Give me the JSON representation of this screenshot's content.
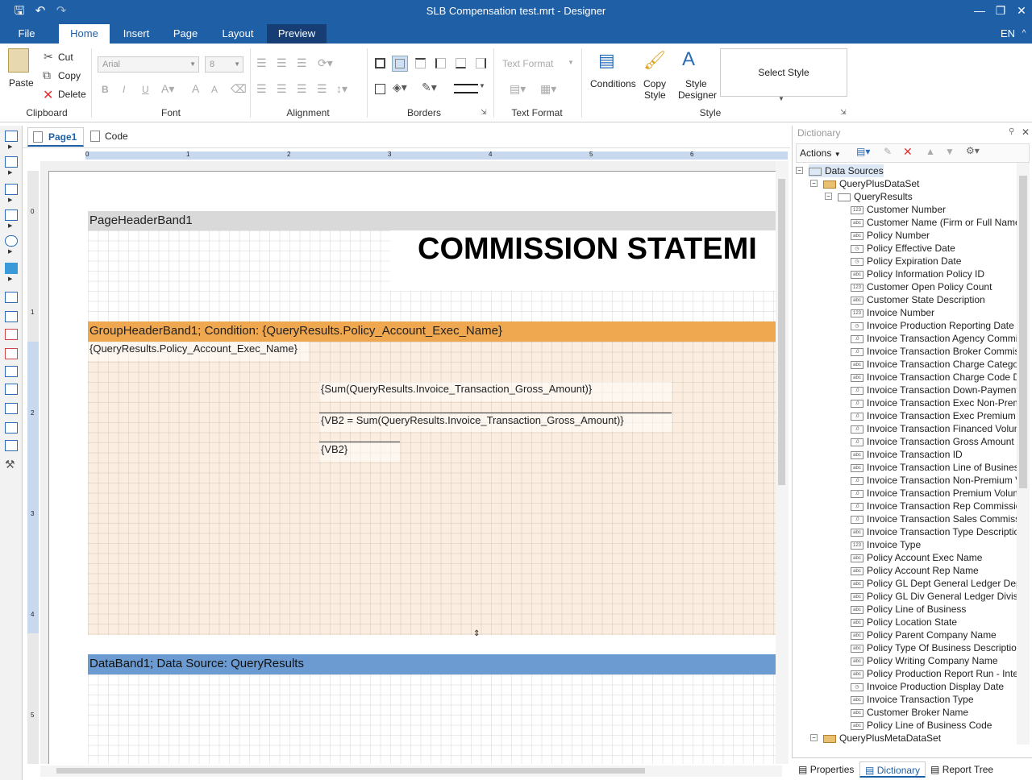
{
  "window": {
    "title": "SLB Compensation test.mrt - Designer",
    "quick_access": [
      "save-icon",
      "undo-icon",
      "redo-icon"
    ],
    "min": "—",
    "max": "❐",
    "close": "✕"
  },
  "menu": {
    "tabs": [
      "File",
      "Home",
      "Insert",
      "Page",
      "Layout",
      "Preview"
    ],
    "active": "Home",
    "language": "EN",
    "collapse": "^"
  },
  "ribbon": {
    "clipboard": {
      "paste": "Paste",
      "cut": "Cut",
      "copy": "Copy",
      "delete": "Delete",
      "label": "Clipboard"
    },
    "font": {
      "family": "Arial",
      "size": "8",
      "label": "Font",
      "bold": "B",
      "italic": "I",
      "underline": "U"
    },
    "alignment": {
      "label": "Alignment"
    },
    "borders": {
      "label": "Borders"
    },
    "text_format": {
      "combo": "Text Format",
      "label": "Text Format"
    },
    "style": {
      "conditions": "Conditions",
      "copy_style_1": "Copy",
      "copy_style_2": "Style",
      "style_designer_1": "Style",
      "style_designer_2": "Designer",
      "select_style": "Select Style",
      "label": "Style"
    }
  },
  "doc_tabs": [
    "Page1",
    "Code"
  ],
  "ruler": {
    "top": [
      "0",
      "1",
      "2",
      "3",
      "4",
      "5",
      "6"
    ],
    "left": [
      "0",
      "1",
      "2",
      "3",
      "4",
      "5"
    ]
  },
  "report": {
    "page_header": "PageHeaderBand1",
    "title_text": "COMMISSION STATEMI",
    "group_header": "GroupHeaderBand1; Condition: {QueryResults.Policy_Account_Exec_Name}",
    "exec_name_field": "{QueryResults.Policy_Account_Exec_Name}",
    "sum_field": "{Sum(QueryResults.Invoice_Transaction_Gross_Amount)}",
    "vb2_assign": "{VB2  =  Sum(QueryResults.Invoice_Transaction_Gross_Amount)}",
    "vb2_field": "{VB2}",
    "data_band": "DataBand1; Data Source: QueryResults"
  },
  "colors": {
    "accent": "#1f5fa6",
    "group_header": "#f0a850",
    "group_body": "#fbeee0",
    "data_band": "#6c9bd2",
    "page_header": "#d9d9d9"
  },
  "dictionary": {
    "title": "Dictionary",
    "actions": "Actions",
    "data_sources": "Data Sources",
    "dataset": "QueryPlusDataSet",
    "table": "QueryResults",
    "meta_dataset": "QueryPlusMetaDataSet",
    "columns": [
      {
        "type": "123",
        "name": "Customer Number"
      },
      {
        "type": "abc",
        "name": "Customer Name (Firm or Full Name)"
      },
      {
        "type": "abc",
        "name": "Policy Number"
      },
      {
        "type": "date",
        "name": "Policy Effective Date"
      },
      {
        "type": "date",
        "name": "Policy Expiration Date"
      },
      {
        "type": "abc",
        "name": "Policy Information Policy ID"
      },
      {
        "type": "123",
        "name": "Customer Open Policy Count"
      },
      {
        "type": "abc",
        "name": "Customer State Description"
      },
      {
        "type": "123",
        "name": "Invoice Number"
      },
      {
        "type": "date",
        "name": "Invoice Production Reporting Date"
      },
      {
        "type": ".0",
        "name": "Invoice Transaction Agency Commissio"
      },
      {
        "type": ".0",
        "name": "Invoice Transaction Broker Commission"
      },
      {
        "type": "abc",
        "name": "Invoice Transaction Charge Category"
      },
      {
        "type": "abc",
        "name": "Invoice Transaction Charge Code Desc"
      },
      {
        "type": ".0",
        "name": "Invoice Transaction Down-Payment Vo"
      },
      {
        "type": ".0",
        "name": "Invoice Transaction Exec Non-Premiun"
      },
      {
        "type": ".0",
        "name": "Invoice Transaction Exec Premium Con"
      },
      {
        "type": ".0",
        "name": "Invoice Transaction Financed Volume"
      },
      {
        "type": ".0",
        "name": "Invoice Transaction Gross Amount"
      },
      {
        "type": "abc",
        "name": "Invoice Transaction ID"
      },
      {
        "type": "abc",
        "name": "Invoice Transaction Line of Business"
      },
      {
        "type": ".0",
        "name": "Invoice Transaction Non-Premium Volu"
      },
      {
        "type": ".0",
        "name": "Invoice Transaction Premium Volume"
      },
      {
        "type": ".0",
        "name": "Invoice Transaction Rep Commission A"
      },
      {
        "type": ".0",
        "name": "Invoice Transaction Sales Commission"
      },
      {
        "type": "abc",
        "name": "Invoice Transaction Type Description"
      },
      {
        "type": "123",
        "name": "Invoice Type"
      },
      {
        "type": "abc",
        "name": "Policy Account Exec Name"
      },
      {
        "type": "abc",
        "name": "Policy Account Rep Name"
      },
      {
        "type": "abc",
        "name": "Policy GL Dept General Ledger Departr"
      },
      {
        "type": "abc",
        "name": "Policy GL Div General Ledger Division I"
      },
      {
        "type": "abc",
        "name": "Policy Line of Business"
      },
      {
        "type": "abc",
        "name": "Policy Location State"
      },
      {
        "type": "abc",
        "name": "Policy Parent Company Name"
      },
      {
        "type": "abc",
        "name": "Policy Type Of Business Description"
      },
      {
        "type": "abc",
        "name": "Policy Writing Company Name"
      },
      {
        "type": "abc",
        "name": "Policy Production Report Run - Internal"
      },
      {
        "type": "date",
        "name": "Invoice Production Display Date"
      },
      {
        "type": "abc",
        "name": "Invoice Transaction Type"
      },
      {
        "type": "abc",
        "name": "Customer Broker Name"
      },
      {
        "type": "abc",
        "name": "Policy Line of Business Code"
      }
    ],
    "bottom_tabs": [
      "Properties",
      "Dictionary",
      "Report Tree"
    ],
    "active_bottom_tab": "Dictionary"
  }
}
